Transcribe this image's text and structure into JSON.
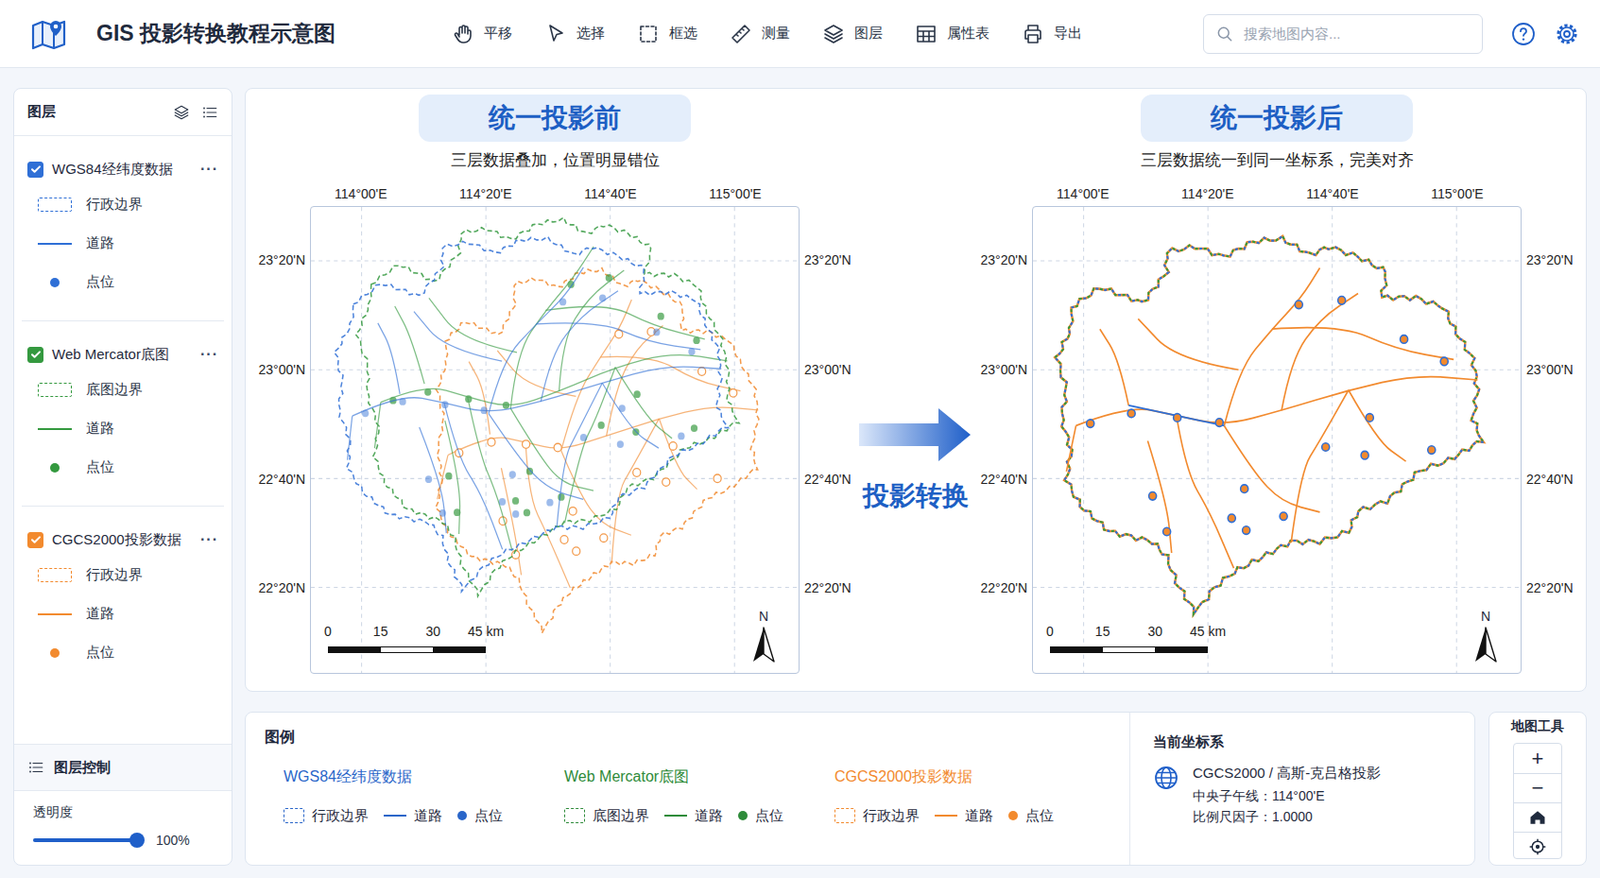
{
  "app": {
    "title": "GIS 投影转换教程示意图"
  },
  "toolbar": [
    {
      "label": "平移"
    },
    {
      "label": "选择"
    },
    {
      "label": "框选"
    },
    {
      "label": "测量"
    },
    {
      "label": "图层"
    },
    {
      "label": "属性表"
    },
    {
      "label": "导出"
    }
  ],
  "search": {
    "placeholder": "搜索地图内容..."
  },
  "sidebar": {
    "title": "图层",
    "layers": [
      {
        "name": "WGS84经纬度数据",
        "checked": true,
        "color": "#2f6fd6",
        "menu": "···",
        "items": [
          {
            "label": "行政边界",
            "kind": "boundary"
          },
          {
            "label": "道路",
            "kind": "road"
          },
          {
            "label": "点位",
            "kind": "point"
          }
        ]
      },
      {
        "name": "Web Mercator底图",
        "checked": true,
        "color": "#34993f",
        "menu": "···",
        "items": [
          {
            "label": "底图边界",
            "kind": "boundary"
          },
          {
            "label": "道路",
            "kind": "road"
          },
          {
            "label": "点位",
            "kind": "point"
          }
        ]
      },
      {
        "name": "CGCS2000投影数据",
        "checked": true,
        "color": "#f28a2e",
        "menu": "···",
        "items": [
          {
            "label": "行政边界",
            "kind": "boundary"
          },
          {
            "label": "道路",
            "kind": "road"
          },
          {
            "label": "点位",
            "kind": "point"
          }
        ]
      }
    ],
    "control": {
      "title": "图层控制",
      "opacity": {
        "label": "透明度",
        "level": 1,
        "reading": "100%"
      }
    }
  },
  "maps": [
    {
      "title": "统一投影前",
      "subtitle": "三层数据叠加，位置明显错位",
      "aligned": false,
      "lon_ticks": [
        "114°00'E",
        "114°20'E",
        "114°40'E",
        "115°00'E"
      ],
      "lat_ticks": [
        "23°20'N",
        "23°00'N",
        "22°40'N",
        "22°20'N"
      ],
      "scale": [
        "0",
        "15",
        "30",
        "45 km"
      ],
      "north": "N"
    },
    {
      "title": "统一投影后",
      "subtitle": "三层数据统一到同一坐标系，完美对齐",
      "aligned": true,
      "lon_ticks": [
        "114°00'E",
        "114°20'E",
        "114°40'E",
        "115°00'E"
      ],
      "lat_ticks": [
        "23°20'N",
        "23°00'N",
        "22°40'N",
        "22°20'N"
      ],
      "scale": [
        "0",
        "15",
        "30",
        "45 km"
      ],
      "north": "N"
    }
  ],
  "features": {
    "points": [
      [
        114.577,
        23.199
      ],
      [
        114.692,
        23.212
      ],
      [
        114.859,
        23.093
      ],
      [
        114.967,
        23.025
      ],
      [
        114.018,
        22.835
      ],
      [
        114.128,
        22.866
      ],
      [
        114.251,
        22.853
      ],
      [
        114.364,
        22.838
      ],
      [
        114.767,
        22.853
      ],
      [
        114.649,
        22.763
      ],
      [
        114.754,
        22.738
      ],
      [
        114.933,
        22.754
      ],
      [
        114.431,
        22.635
      ],
      [
        114.185,
        22.613
      ],
      [
        114.536,
        22.551
      ],
      [
        114.397,
        22.545
      ],
      [
        114.436,
        22.508
      ],
      [
        114.223,
        22.504
      ]
    ]
  },
  "transform": {
    "label": "投影转换"
  },
  "legend": {
    "title": "图例",
    "groups": [
      {
        "name": "WGS84经纬度数据",
        "color": "#2a66c9",
        "items": [
          {
            "label": "行政边界",
            "kind": "boundary"
          },
          {
            "label": "道路",
            "kind": "road"
          },
          {
            "label": "点位",
            "kind": "point"
          }
        ]
      },
      {
        "name": "Web Mercator底图",
        "color": "#2e8b3a",
        "items": [
          {
            "label": "底图边界",
            "kind": "boundary"
          },
          {
            "label": "道路",
            "kind": "road"
          },
          {
            "label": "点位",
            "kind": "point"
          }
        ]
      },
      {
        "name": "CGCS2000投影数据",
        "color": "#f28a2e",
        "items": [
          {
            "label": "行政边界",
            "kind": "boundary"
          },
          {
            "label": "道路",
            "kind": "road"
          },
          {
            "label": "点位",
            "kind": "point"
          }
        ]
      }
    ]
  },
  "crs": {
    "title": "当前坐标系",
    "name": "CGCS2000 / 高斯-克吕格投影",
    "lines": [
      "中央子午线：114°00'E",
      "比例尺因子：1.0000"
    ]
  },
  "tools": {
    "title": "地图工具",
    "buttons": [
      "+",
      "−"
    ]
  }
}
